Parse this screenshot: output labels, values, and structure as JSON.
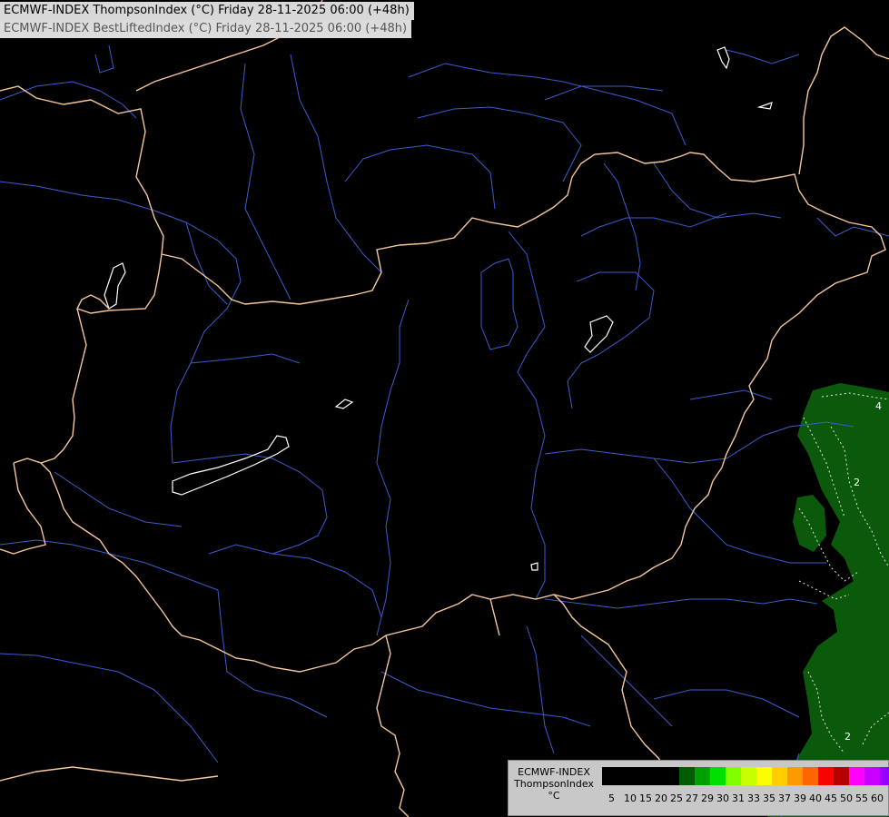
{
  "titles": {
    "line1": "ECMWF-INDEX ThompsonIndex (°C) Friday 28-11-2025 06:00 (+48h)",
    "line2": "ECMWF-INDEX BestLiftedIndex (°C) Friday 28-11-2025 06:00 (+48h)"
  },
  "legend": {
    "line1": "ECMWF-INDEX",
    "line2": "ThompsonIndex",
    "line3": "°C",
    "colors": [
      "#000000",
      "#000000",
      "#000000",
      "#000000",
      "#000000",
      "#005c00",
      "#00a000",
      "#00e000",
      "#80ff00",
      "#c8ff00",
      "#ffff00",
      "#ffcc00",
      "#ff9900",
      "#ff6600",
      "#ff0000",
      "#b40000",
      "#ff00ff",
      "#c800ff",
      "#9600ff",
      "#6400ff",
      "#0000ff"
    ],
    "ticks": [
      "5",
      "10",
      "15",
      "20",
      "25",
      "27",
      "29",
      "30",
      "31",
      "33",
      "35",
      "37",
      "39",
      "40",
      "45",
      "50",
      "55",
      "60"
    ]
  },
  "contours": {
    "labels": [
      "4",
      "2",
      "2"
    ],
    "fill_color": "#0b5a0b"
  },
  "map_colors": {
    "background": "#000000",
    "borders": "#f5c79a",
    "rivers": "#3c5ccf",
    "lakes": "#ffffff"
  }
}
